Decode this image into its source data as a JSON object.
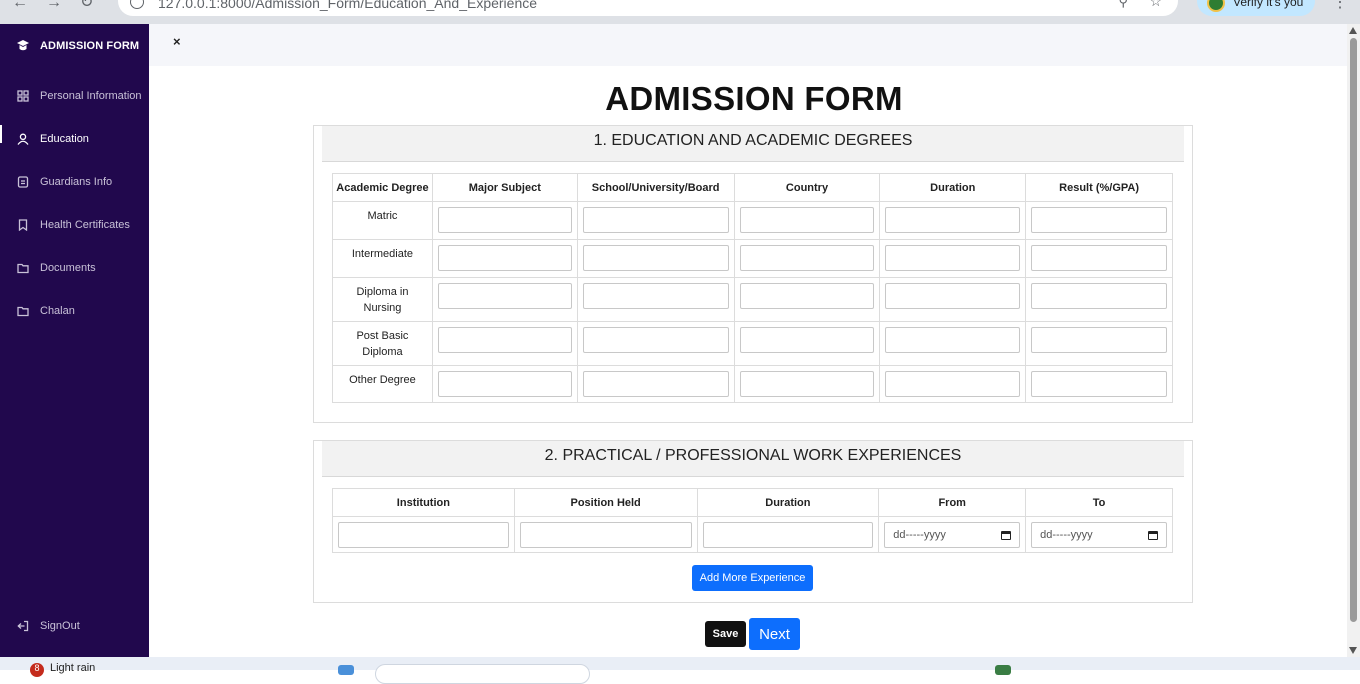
{
  "browser": {
    "url": "127.0.0.1:8000/Admission_Form/Education_And_Experience",
    "profile_label": "Verify it's you"
  },
  "sidebar": {
    "brand": "ADMISSION FORM",
    "items": [
      {
        "label": "Personal Information",
        "icon": "grid-icon",
        "active": false
      },
      {
        "label": "Education",
        "icon": "user-icon",
        "active": true
      },
      {
        "label": "Guardians Info",
        "icon": "document-icon",
        "active": false
      },
      {
        "label": "Health Certificates",
        "icon": "bookmark-icon",
        "active": false
      },
      {
        "label": "Documents",
        "icon": "folder-icon",
        "active": false
      },
      {
        "label": "Chalan",
        "icon": "folder-icon",
        "active": false
      }
    ],
    "signout": "SignOut"
  },
  "topbar": {
    "close": "×"
  },
  "page": {
    "title": "ADMISSION FORM"
  },
  "education": {
    "heading": "1. EDUCATION AND ACADEMIC DEGREES",
    "columns": [
      "Academic Degree",
      "Major Subject",
      "School/University/Board",
      "Country",
      "Duration",
      "Result (%/GPA)"
    ],
    "rows": [
      "Matric",
      "Intermediate",
      "Diploma in Nursing",
      "Post Basic Diploma",
      "Other Degree"
    ]
  },
  "experience": {
    "heading": "2. PRACTICAL / PROFESSIONAL WORK EXPERIENCES",
    "columns": [
      "Institution",
      "Position Held",
      "Duration",
      "From",
      "To"
    ],
    "date_placeholder_from": "dd-----yyyy",
    "date_placeholder_to": "dd-----yyyy",
    "add_button": "Add More Experience"
  },
  "actions": {
    "save": "Save",
    "next": "Next"
  },
  "taskbar": {
    "notification_count": "8",
    "widget_text": "Light rain"
  },
  "colors": {
    "sidebar_bg": "#21084d",
    "primary": "#0d6efd",
    "dark_button": "#111111"
  }
}
